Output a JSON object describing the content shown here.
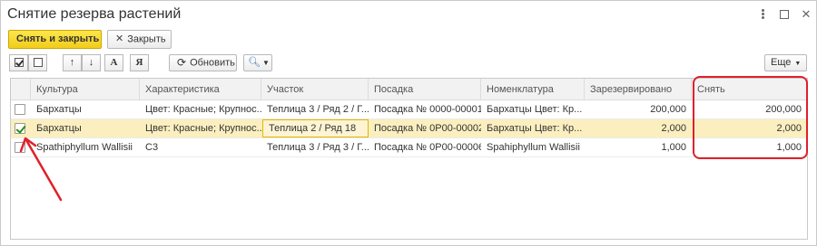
{
  "window": {
    "title": "Снятие резерва растений"
  },
  "actions": {
    "release_close_label": "Снять и закрыть",
    "close_label": "Закрыть"
  },
  "toolbar": {
    "font_a_label": "А",
    "font_ya_label": "Я",
    "refresh_label": "Обновить",
    "more_label": "Еще"
  },
  "table": {
    "columns": [
      "Культура",
      "Характеристика",
      "Участок",
      "Посадка",
      "Номенклатура",
      "Зарезервировано",
      "Снять"
    ],
    "rows": [
      {
        "checked": false,
        "culture": "Бархатцы",
        "characteristic": "Цвет: Красные; Крупнос...",
        "plot": "Теплица 3 / Ряд 2 / Г...",
        "planting": "Посадка № 0000-00001...",
        "nomenclature": "Бархатцы Цвет: Кр...",
        "reserved": "200,000",
        "release": "200,000"
      },
      {
        "checked": true,
        "culture": "Бархатцы",
        "characteristic": "Цвет: Красные; Крупнос...",
        "plot": "Теплица 2 / Ряд 18",
        "planting": "Посадка № 0P00-00002...",
        "nomenclature": "Бархатцы Цвет: Кр...",
        "reserved": "2,000",
        "release": "2,000"
      },
      {
        "checked": false,
        "culture": "Spathiphyllum Wallisii",
        "characteristic": "C3",
        "plot": "Теплица 3 / Ряд 3 / Г...",
        "planting": "Посадка № 0P00-00006...",
        "nomenclature": "Spahiphyllum Wallisii",
        "reserved": "1,000",
        "release": "1,000"
      }
    ]
  },
  "colors": {
    "primary_button": "#f2cc1b",
    "selected_row": "#fbefc0",
    "annotation": "#e0202a",
    "check_green": "#2e8a1c"
  }
}
